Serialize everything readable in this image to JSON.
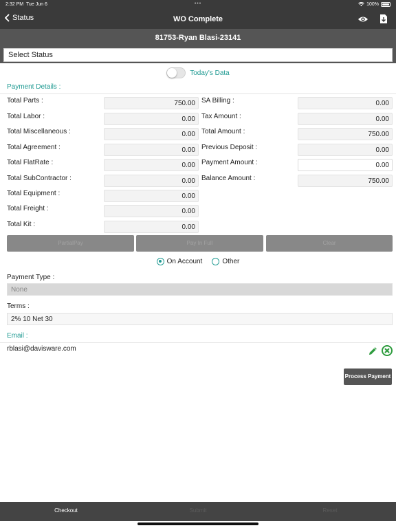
{
  "status_bar": {
    "time": "2:32 PM",
    "date": "Tue Jun 6",
    "center": "•••",
    "battery": "100%"
  },
  "nav": {
    "back_label": "Status",
    "title": "WO Complete",
    "icons": [
      "eye-icon",
      "document-icon"
    ]
  },
  "work_order": {
    "header": "81753-Ryan Blasi-23141"
  },
  "status_select": {
    "placeholder": "Select Status"
  },
  "todays_data": {
    "label": "Today's Data",
    "enabled": false
  },
  "payment_details": {
    "title": "Payment Details :",
    "left": [
      {
        "label": "Total Parts :",
        "value": "750.00"
      },
      {
        "label": "Total Labor :",
        "value": "0.00"
      },
      {
        "label": "Total Miscellaneous :",
        "value": "0.00"
      },
      {
        "label": "Total Agreement :",
        "value": "0.00"
      },
      {
        "label": "Total FlatRate :",
        "value": "0.00"
      },
      {
        "label": "Total SubContractor :",
        "value": "0.00"
      },
      {
        "label": "Total Equipment :",
        "value": "0.00"
      },
      {
        "label": "Total Freight :",
        "value": "0.00"
      },
      {
        "label": "Total Kit :",
        "value": "0.00"
      }
    ],
    "right": [
      {
        "label": "SA Billing :",
        "value": "0.00"
      },
      {
        "label": "Tax Amount :",
        "value": "0.00"
      },
      {
        "label": "Total Amount :",
        "value": "750.00"
      },
      {
        "label": "Previous Deposit :",
        "value": "0.00"
      },
      {
        "label": "Payment Amount :",
        "value": "0.00"
      },
      {
        "label": "Balance Amount :",
        "value": "750.00"
      }
    ]
  },
  "actions": {
    "partial_pay": "PartialPay",
    "pay_in_full": "Pay In Full",
    "clear": "Clear"
  },
  "payment_mode": {
    "options": [
      "On Account",
      "Other"
    ],
    "selected": "On Account"
  },
  "payment_type": {
    "label": "Payment Type :",
    "value": "None"
  },
  "terms": {
    "label": "Terms :",
    "value": "2% 10 Net 30"
  },
  "email": {
    "label": "Email :",
    "value": "rblasi@davisware.com"
  },
  "process_payment": {
    "label": "Process Payment"
  },
  "bottom_tabs": [
    {
      "label": "Checkout",
      "active": true
    },
    {
      "label": "Submit",
      "active": false
    },
    {
      "label": "Reset",
      "active": false
    }
  ],
  "colors": {
    "accent": "#1f9a92",
    "dark_bar": "#3a3a3a",
    "header_bar": "#555555",
    "edit_icon": "#2e9c3e"
  }
}
